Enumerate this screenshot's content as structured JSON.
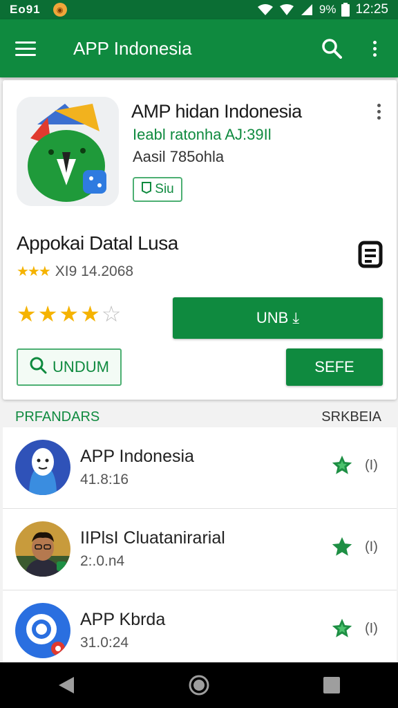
{
  "status_bar": {
    "carrier": "Eo91",
    "battery": "9%",
    "time": "12:25"
  },
  "app_bar": {
    "title": "APP Indonesia"
  },
  "app": {
    "title": "AMP hidan Indonesia",
    "subtitle1": "Ieabl ratonha AJ:39Il",
    "subtitle2": "Aasil 785ohla",
    "badge_label": "Siu"
  },
  "detail": {
    "section_title": "Appokai Datal Lusa",
    "rating_text": "XI9 14.2068",
    "star_rating": 4,
    "install_label": "UNB ⤓",
    "undum_label": "UNDUM",
    "sefe_label": "SEFE"
  },
  "list_header": {
    "left": "PRFANDARS",
    "right": "SRKBEIA"
  },
  "list": [
    {
      "title": "APP Indonesia",
      "subtitle": "41.8:16",
      "count": "(I)"
    },
    {
      "title": "IIPlsI Cluatanirarial",
      "subtitle": "2:.0.n4",
      "count": "(I)"
    },
    {
      "title": "APP Kbrda",
      "subtitle": "31.0:24",
      "count": "(I)"
    }
  ],
  "colors": {
    "primary": "#0f8a3f",
    "status_bar": "#0b6e34",
    "star": "#f5b301"
  },
  "icons": [
    "hamburger-icon",
    "search-icon",
    "overflow-menu-icon",
    "document-icon",
    "star-icon",
    "back-icon",
    "home-icon",
    "recents-icon"
  ]
}
